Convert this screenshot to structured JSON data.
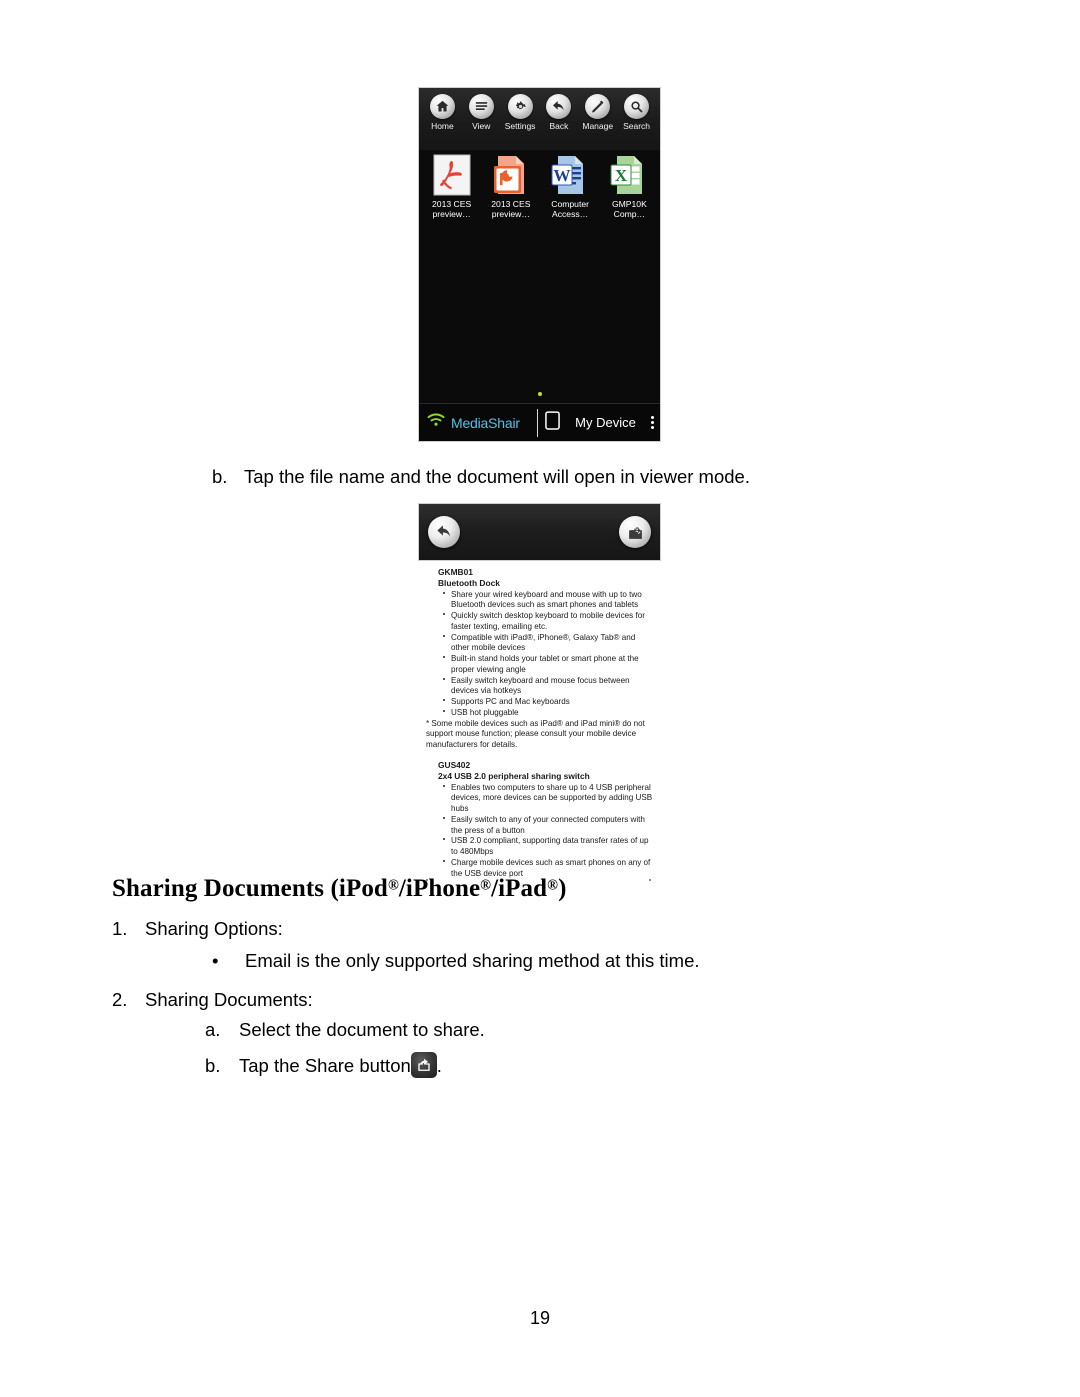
{
  "page": {
    "number": "19"
  },
  "screenshot_file_browser": {
    "toolbar": [
      {
        "icon": "home-icon",
        "label": "Home"
      },
      {
        "icon": "list-icon",
        "label": "View"
      },
      {
        "icon": "gear-icon",
        "label": "Settings"
      },
      {
        "icon": "back-arrow-icon",
        "label": "Back"
      },
      {
        "icon": "pencil-icon",
        "label": "Manage"
      },
      {
        "icon": "search-icon",
        "label": "Search"
      }
    ],
    "files": [
      {
        "type": "pdf-file-icon",
        "name_line1": "2013 CES",
        "name_line2": "preview…"
      },
      {
        "type": "powerpoint-file-icon",
        "name_line1": "2013 CES",
        "name_line2": "preview…"
      },
      {
        "type": "word-file-icon",
        "name_line1": "Computer",
        "name_line2": "Access…"
      },
      {
        "type": "excel-file-icon",
        "name_line1": "GMP10K",
        "name_line2": "Comp…"
      }
    ],
    "bottom_bar": {
      "wifi_icon": "wifi-icon",
      "brand": "MediaShair",
      "device_icon": "tablet-icon",
      "device_label": "My Device",
      "overflow_icon": "kebab-menu-icon"
    },
    "colors": {
      "brand_text": "#4fc3e8",
      "page_dot": "#c8e020",
      "background": "#0b0b0b"
    }
  },
  "screenshot_document_viewer": {
    "toolbar": {
      "back_icon": "back-arrow-icon",
      "share_icon": "share-icon"
    },
    "document": {
      "section1": {
        "model": "GKMB01",
        "title": "Bluetooth Dock",
        "bullets": [
          "Share your wired keyboard and mouse with up to two Bluetooth devices such as smart phones and tablets",
          "Quickly switch desktop keyboard to mobile devices for faster texting, emailing etc.",
          "Compatible with iPad®, iPhone®, Galaxy Tab® and other mobile devices",
          "Built-in stand holds your tablet or smart phone at the proper viewing angle",
          "Easily switch keyboard and mouse focus between devices via hotkeys",
          "Supports PC and Mac keyboards",
          "USB hot pluggable"
        ],
        "footnote": "* Some mobile devices such as iPad® and iPad mini® do not support mouse function; please consult your mobile device manufacturers for details."
      },
      "section2": {
        "model": "GUS402",
        "title": "2x4 USB 2.0 peripheral sharing switch",
        "bullets": [
          "Enables two computers to share up to 4 USB peripheral devices, more devices can be supported by adding USB hubs",
          "Easily switch to any of your connected computers with the press of a button",
          "USB 2.0 compliant, supporting data transfer rates of up to 480Mbps",
          "Charge mobile devices such as smart phones on any of the USB device port"
        ]
      }
    }
  },
  "content": {
    "step_b_viewer": {
      "marker": "b.",
      "text": "Tap the file name and the document will open in viewer mode."
    },
    "heading_prefix": "Sharing Documents (iPod",
    "heading_mid1": "/iPhone",
    "heading_mid2": "/iPad",
    "heading_suffix": ")",
    "reg_mark": "®",
    "list": {
      "item1_marker": "1.",
      "item1_text": "Sharing Options:",
      "item1_bullet_marker": "•",
      "item1_bullet_text": "Email is the only supported sharing method at this time.",
      "item2_marker": "2.",
      "item2_text": "Sharing Documents:",
      "item2_a_marker": "a.",
      "item2_a_text": "Select the document to share.",
      "item2_b_marker": "b.",
      "item2_b_text_before": "Tap the Share button",
      "item2_b_icon": "share-icon",
      "item2_b_text_after": "."
    }
  }
}
